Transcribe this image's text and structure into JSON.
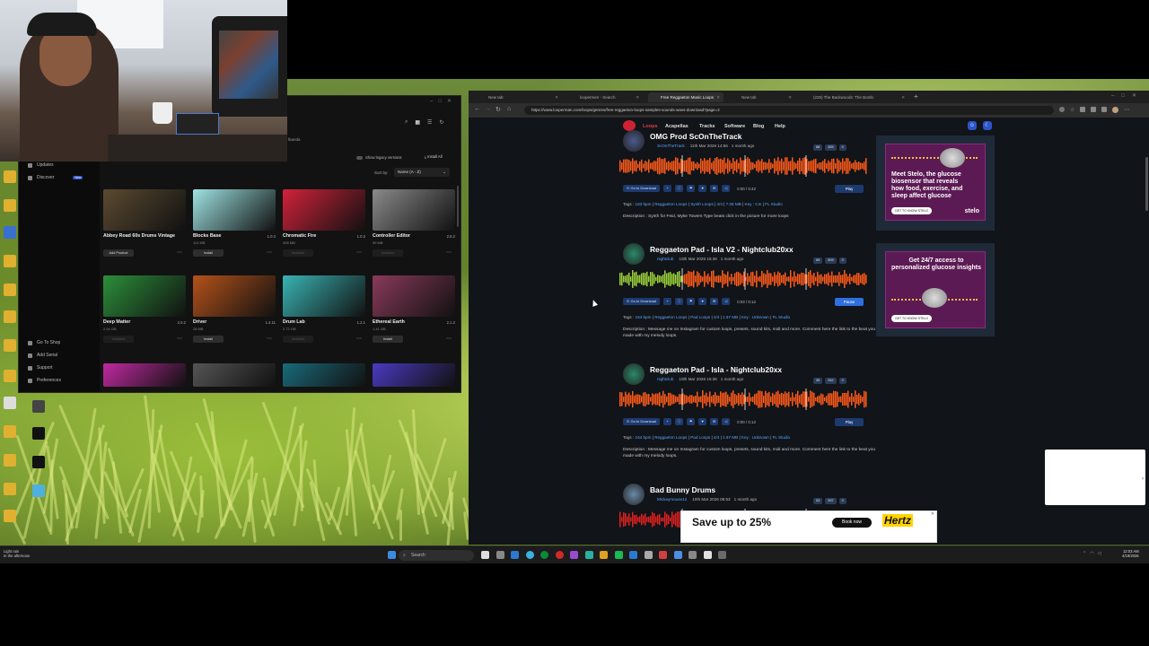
{
  "native_access": {
    "sidebar": {
      "updates": "Updates",
      "discover": "Discover",
      "discover_badge": "New",
      "user_fragment": "lbanda",
      "go_to_shop": "Go To Shop",
      "add_serial": "Add Serial",
      "support": "Support",
      "preferences": "Preferences"
    },
    "toolbar": {
      "show_legacy": "Show legacy versions",
      "install_all": "Install All",
      "sort_label": "Sort by:",
      "sort_value": "Name (A - Z)"
    },
    "products": [
      {
        "name": "Abbey Road 60s Drums Vintage",
        "version": "",
        "size": "",
        "button": "Add Product",
        "color": "#5b4a30"
      },
      {
        "name": "Blocks Base",
        "version": "1.0.3",
        "size": "114 MB",
        "button": "Install",
        "color": "#9fe3e3"
      },
      {
        "name": "Chromatic Fire",
        "version": "1.0.3",
        "size": "498 MB",
        "button": "Installed",
        "color": "#d1223a"
      },
      {
        "name": "Controller Editor",
        "version": "2.8.2",
        "size": "59 MB",
        "button": "Installed",
        "color": "#8a8a8a"
      },
      {
        "name": "Deep Matter",
        "version": "2.0.2",
        "size": "2.04 GB",
        "button": "Installed",
        "color": "#2c8f3a"
      },
      {
        "name": "Driver",
        "version": "1.4.11",
        "size": "28 MB",
        "button": "Install",
        "color": "#b4521a"
      },
      {
        "name": "Drum Lab",
        "version": "1.2.1",
        "size": "2.72 GB",
        "button": "Installed",
        "color": "#3ab3b3"
      },
      {
        "name": "Ethereal Earth",
        "version": "2.1.2",
        "size": "1.41 GB",
        "button": "Install",
        "color": "#8a3a5a"
      }
    ]
  },
  "browser": {
    "tabs": [
      {
        "label": "New tab",
        "active": false
      },
      {
        "label": "loopermen - Search",
        "active": false
      },
      {
        "label": "Free Reggaeton Music Loops",
        "active": true
      },
      {
        "label": "New tab",
        "active": false
      },
      {
        "label": "(225) The Backwoods: The Bomb",
        "active": false
      }
    ],
    "url": "https://www.looperman.com/loops/genres/free-reggaeton-loops-samples-sounds-wavs-download?page=2",
    "nav": [
      "Loops",
      "Acapellas",
      "Tracks",
      "Software",
      "Blog",
      "Help"
    ],
    "loops": [
      {
        "title": "OMG Prod ScOnTheTrack",
        "user": "ScOnTheTrack",
        "date": "11th Mar 2026 14:56",
        "ago": "1 month ago",
        "stats": [
          "68",
          "455",
          "0"
        ],
        "time": "0:00 / 0:42",
        "play": "Play",
        "tags": [
          "183 bpm",
          "Reggaeton Loops",
          "Synth Loops",
          "4/4",
          "7.06 MB",
          "Key : Cm",
          "FL Studio"
        ],
        "description": "Description : Synth for Feid, Myke Towers Type beats click in the picture for more loops",
        "wave_color": "#ff5a1a",
        "played_fraction": 0
      },
      {
        "title": "Reggaeton Pad - Isla V2 - Nightclub20xx",
        "user": "nightclub",
        "date": "10th Mar 2026 16:36",
        "ago": "1 month ago",
        "stats": [
          "69",
          "509",
          "0"
        ],
        "time": "0:03 / 0:12",
        "play": "Pause",
        "tags": [
          "164 bpm",
          "Reggaeton Loops",
          "Pad Loops",
          "4/4",
          "1.97 MB",
          "Key : Unknown",
          "FL Studio"
        ],
        "description": "Description : Message me on Instagram for custom loops, presets, sound kits, midi and more. Comment here the link to the beat you made with my melody loops.",
        "wave_color": "#ff5a1a",
        "played_fraction": 0.25
      },
      {
        "title": "Reggaeton Pad - Isla - Nightclub20xx",
        "user": "nightclub",
        "date": "10th Mar 2026 16:36",
        "ago": "1 month ago",
        "stats": [
          "35",
          "262",
          "0"
        ],
        "time": "0:00 / 0:12",
        "play": "Play",
        "tags": [
          "164 bpm",
          "Reggaeton Loops",
          "Pad Loops",
          "4/4",
          "1.97 MB",
          "Key : Unknown",
          "FL Studio"
        ],
        "description": "Description : Message me on Instagram for custom loops, presets, sound kits, midi and more. Comment here the link to the beat you made with my melody loops.",
        "wave_color": "#ff5a1a",
        "played_fraction": 0
      },
      {
        "title": "Bad Bunny Drums",
        "user": "Mickeymouse12",
        "date": "10th Mar 2026 06:53",
        "ago": "1 month ago",
        "stats": [
          "53",
          "397",
          "0"
        ],
        "time": "",
        "play": "",
        "tags": [],
        "description": "",
        "wave_color": "#e02020",
        "played_fraction": 0
      }
    ],
    "ads": [
      {
        "text": "Meet Stelo, the glucose biosensor that reveals how food, exercise, and sleep affect glucose",
        "button": "GET TO KNOW STELO",
        "brand": "stelo"
      },
      {
        "text": "Get 24/7 access to personalized glucose insights",
        "button": "GET TO KNOW STELO",
        "brand": ""
      }
    ],
    "bottom_ad": {
      "headline": "Save up to 25%",
      "button": "Book now",
      "brand": "Hertz"
    }
  },
  "taskbar": {
    "search": "Search",
    "weather_line1": "Light rain",
    "weather_line2": "In the afternoon",
    "clock_time": "12:03 AM",
    "clock_date": "4/19/2026"
  }
}
